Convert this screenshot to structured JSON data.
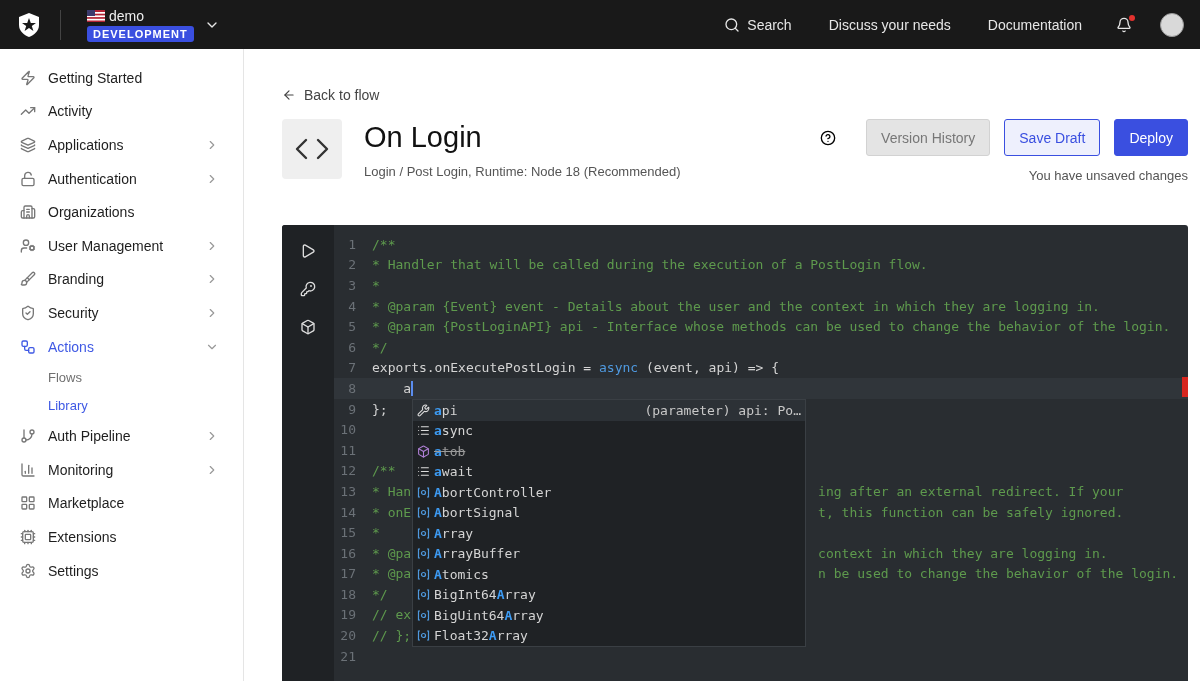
{
  "topbar": {
    "tenant": "demo",
    "environment": "DEVELOPMENT",
    "links": [
      {
        "kind": "search",
        "label": "Search"
      },
      {
        "kind": "link",
        "label": "Discuss your needs"
      },
      {
        "kind": "link",
        "label": "Documentation"
      }
    ],
    "notification": true
  },
  "sidebar": {
    "items": [
      {
        "label": "Getting Started",
        "selected": false
      },
      {
        "label": "Activity",
        "selected": false
      },
      {
        "label": "Applications",
        "selected": false,
        "expanded": false
      },
      {
        "label": "Authentication",
        "selected": false,
        "expanded": false
      },
      {
        "label": "Organizations",
        "selected": false
      },
      {
        "label": "User Management",
        "selected": false,
        "expanded": false
      },
      {
        "label": "Branding",
        "selected": false,
        "expanded": false
      },
      {
        "label": "Security",
        "selected": false,
        "expanded": false
      },
      {
        "label": "Actions",
        "selected": true,
        "expanded": true,
        "children": [
          {
            "label": "Flows",
            "selected": false
          },
          {
            "label": "Library",
            "selected": true
          }
        ]
      },
      {
        "label": "Auth Pipeline",
        "selected": false,
        "expanded": false
      },
      {
        "label": "Monitoring",
        "selected": false,
        "expanded": false
      },
      {
        "label": "Marketplace",
        "selected": false
      },
      {
        "label": "Extensions",
        "selected": false
      },
      {
        "label": "Settings",
        "selected": false
      }
    ]
  },
  "header": {
    "back": "Back to flow",
    "title": "On Login",
    "subtitle": "Login / Post Login, Runtime: Node 18 (Recommended)",
    "buttons": [
      {
        "kind": "disabled",
        "label": "Version History"
      },
      {
        "kind": "secondary",
        "label": "Save Draft"
      },
      {
        "kind": "primary",
        "label": "Deploy"
      }
    ],
    "status": "You have unsaved changes"
  },
  "editor": {
    "lines": [
      {
        "n": "1",
        "tokens": [
          {
            "kind": "comment",
            "text": "/**"
          }
        ]
      },
      {
        "n": "2",
        "tokens": [
          {
            "kind": "comment",
            "text": "* Handler that will be called during the execution of a PostLogin flow."
          }
        ]
      },
      {
        "n": "3",
        "tokens": [
          {
            "kind": "comment",
            "text": "*"
          }
        ]
      },
      {
        "n": "4",
        "tokens": [
          {
            "kind": "comment",
            "text": "* @param {Event} event - Details about the user and the context in which they are logging in."
          }
        ]
      },
      {
        "n": "5",
        "tokens": [
          {
            "kind": "comment",
            "text": "* @param {PostLoginAPI} api - Interface whose methods can be used to change the behavior of the login."
          }
        ]
      },
      {
        "n": "6",
        "tokens": [
          {
            "kind": "comment",
            "text": "*/"
          }
        ]
      },
      {
        "n": "7",
        "tokens": [
          {
            "kind": "plain",
            "text": "exports.onExecutePostLogin = "
          },
          {
            "kind": "keyword",
            "text": "async"
          },
          {
            "kind": "plain",
            "text": " (event, api) => {"
          }
        ]
      },
      {
        "n": "8",
        "tokens": [
          {
            "kind": "plain",
            "text": "    a"
          }
        ],
        "current": true
      },
      {
        "n": "9",
        "tokens": [
          {
            "kind": "plain",
            "text": "};"
          }
        ]
      },
      {
        "n": "10"
      },
      {
        "n": "11"
      },
      {
        "n": "12",
        "tokens": [
          {
            "kind": "comment",
            "text": "/**"
          }
        ]
      },
      {
        "n": "13",
        "tokens": [
          {
            "kind": "comment",
            "text": "* Han"
          }
        ],
        "tail": "ing after an external redirect. If your"
      },
      {
        "n": "14",
        "tokens": [
          {
            "kind": "comment",
            "text": "* onE"
          }
        ],
        "tail": "t, this function can be safely ignored."
      },
      {
        "n": "15",
        "tokens": [
          {
            "kind": "comment",
            "text": "*"
          }
        ]
      },
      {
        "n": "16",
        "tokens": [
          {
            "kind": "comment",
            "text": "* @pa"
          }
        ],
        "tail": "context in which they are logging in."
      },
      {
        "n": "17",
        "tokens": [
          {
            "kind": "comment",
            "text": "* @pa"
          }
        ],
        "tail": "n be used to change the behavior of the login."
      },
      {
        "n": "18",
        "tokens": [
          {
            "kind": "comment",
            "text": "*/"
          }
        ]
      },
      {
        "n": "19",
        "tokens": [
          {
            "kind": "comment",
            "text": "// ex"
          }
        ]
      },
      {
        "n": "20",
        "tokens": [
          {
            "kind": "comment",
            "text": "// };"
          }
        ]
      },
      {
        "n": "21"
      }
    ],
    "suggestions": [
      {
        "kind": "parameter",
        "match": "a",
        "after": "pi",
        "detail": "(parameter) api: Po…",
        "selected": true,
        "deprecated": false
      },
      {
        "kind": "keyword",
        "match": "a",
        "after": "sync",
        "selected": false,
        "deprecated": false
      },
      {
        "kind": "module",
        "match": "a",
        "after": "tob",
        "selected": false,
        "deprecated": true
      },
      {
        "kind": "keyword",
        "match": "a",
        "after": "wait",
        "selected": false,
        "deprecated": false
      },
      {
        "kind": "variable",
        "match": "A",
        "after": "bortController",
        "selected": false,
        "deprecated": false
      },
      {
        "kind": "variable",
        "match": "A",
        "after": "bortSignal",
        "selected": false,
        "deprecated": false
      },
      {
        "kind": "variable",
        "match": "A",
        "after": "rray",
        "selected": false,
        "deprecated": false
      },
      {
        "kind": "variable",
        "match": "A",
        "after": "rrayBuffer",
        "selected": false,
        "deprecated": false
      },
      {
        "kind": "variable",
        "match": "A",
        "after": "tomics",
        "selected": false,
        "deprecated": false
      },
      {
        "kind": "variable",
        "before": "BigInt64",
        "match": "A",
        "after": "rray",
        "selected": false,
        "deprecated": false
      },
      {
        "kind": "variable",
        "before": "BigUint64",
        "match": "A",
        "after": "rray",
        "selected": false,
        "deprecated": false
      },
      {
        "kind": "variable",
        "before": "Float32",
        "match": "A",
        "after": "rray",
        "selected": false,
        "deprecated": false
      }
    ]
  }
}
